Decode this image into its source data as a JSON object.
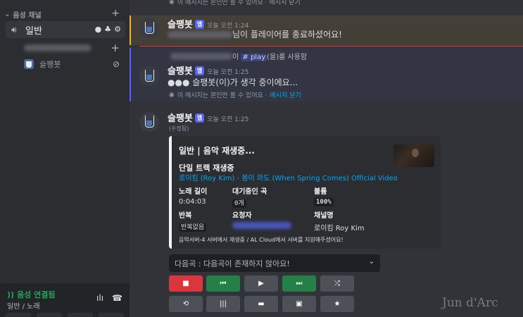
{
  "sidebar": {
    "category": "음성 채널",
    "voice_channel": "일반",
    "bot_member": "슬팽봇"
  },
  "voice_status": {
    "title": "음성 연결됨",
    "subtitle": "일반 / 노래"
  },
  "messages": {
    "top_eph_note": "이 메시지는 본인만 볼 수 있어요 · 메시지 닫기",
    "m1": {
      "user": "슬팽봇",
      "badge": "앱",
      "time": "오늘 오전 1:24",
      "text": "님이 플레이어를 종료하셨어요!"
    },
    "reply_preview": {
      "text_pre": "이",
      "command": "# play",
      "text_post": "(을)를 사용함"
    },
    "m2": {
      "user": "슬팽봇",
      "badge": "앱",
      "time": "오늘 오전 1:25",
      "text": "●●● 슬팽봇(이)가 생각 중이에요...",
      "eph": "이 메시지는 본인만 볼 수 있어요 ·",
      "eph_link": "메시지 닫기"
    },
    "m3": {
      "user": "슬팽봇",
      "badge": "앱",
      "time": "오늘 오전 1:25",
      "edited": "(수정됨)"
    }
  },
  "embed": {
    "title": "일반 | 음악 재생중...",
    "subtitle": "단일 트랙 재생중",
    "link": "로이킴 (Roy Kim) - 봄이 와도 (When Spring Comes) Official Video",
    "fields": {
      "length_name": "노래 길이",
      "length_value": "0:04:03",
      "queue_name": "대기중인 곡",
      "queue_value": "0개",
      "volume_name": "볼륨",
      "volume_value": "100%",
      "repeat_name": "반복",
      "repeat_value": "반복없음",
      "requester_name": "요청자",
      "channel_name": "채널명",
      "channel_value": "로이킴 Roy Kim"
    },
    "footer": "음악서버-4 서버에서 재생중 / AL Cloud에서 서버를 지원해주셨어요!"
  },
  "select": {
    "placeholder": "다음곡 : 다음곡이 존재하지 않아요!"
  },
  "buttons": [
    "■",
    "⏮",
    "▶",
    "⏭",
    "⤮",
    "⟲",
    "|||",
    "▬",
    "▣",
    "★"
  ],
  "watermark": "Jun d'Arc"
}
